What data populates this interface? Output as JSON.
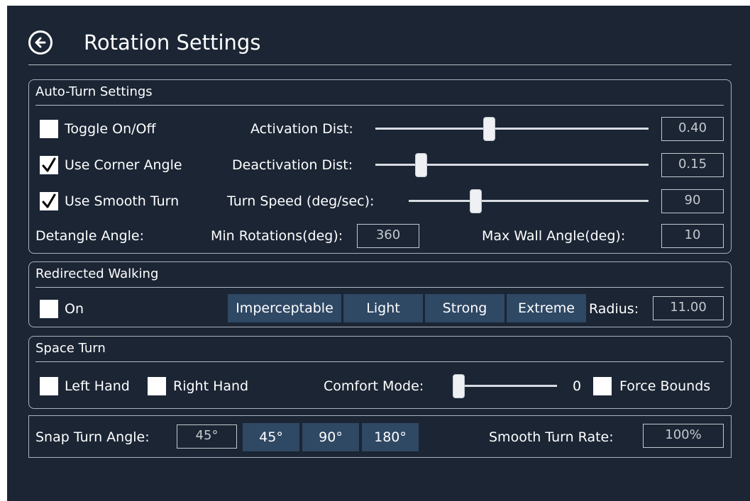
{
  "header": {
    "title": "Rotation Settings"
  },
  "auto_turn": {
    "section_title": "Auto-Turn Settings",
    "toggle_label": "Toggle On/Off",
    "toggle_checked": false,
    "corner_label": "Use Corner Angle",
    "corner_checked": true,
    "smooth_label": "Use Smooth Turn",
    "smooth_checked": true,
    "activation_label": "Activation Dist:",
    "activation_value": "0.40",
    "activation_level": 0.4,
    "deactivation_label": "Deactivation Dist:",
    "deactivation_value": "0.15",
    "deactivation_level": 0.15,
    "turn_speed_label": "Turn Speed (deg/sec):",
    "turn_speed_value": "90",
    "turn_speed_level": 0.26,
    "detangle_label": "Detangle Angle:",
    "min_rot_label": "Min Rotations(deg):",
    "min_rot_value": "360",
    "max_wall_label": "Max Wall Angle(deg):",
    "max_wall_value": "10"
  },
  "redirected": {
    "section_title": "Redirected Walking",
    "on_label": "On",
    "on_checked": false,
    "presets": [
      "Imperceptable",
      "Light",
      "Strong",
      "Extreme"
    ],
    "radius_label": "Radius:",
    "radius_value": "11.00"
  },
  "space_turn": {
    "section_title": "Space Turn",
    "left_hand_label": "Left Hand",
    "left_hand_checked": false,
    "right_hand_label": "Right Hand",
    "right_hand_checked": false,
    "comfort_label": "Comfort Mode:",
    "comfort_value": "0",
    "comfort_level": 0,
    "force_bounds_label": "Force Bounds",
    "force_bounds_checked": false
  },
  "snap": {
    "snap_label": "Snap Turn Angle:",
    "snap_value": "45°",
    "snap_options": [
      "45°",
      "90°",
      "180°"
    ],
    "smooth_rate_label": "Smooth Turn Rate:",
    "smooth_rate_value": "100%"
  },
  "colors": {
    "background": "#1b2534",
    "button": "#2f4864",
    "border": "#aab0ba"
  }
}
